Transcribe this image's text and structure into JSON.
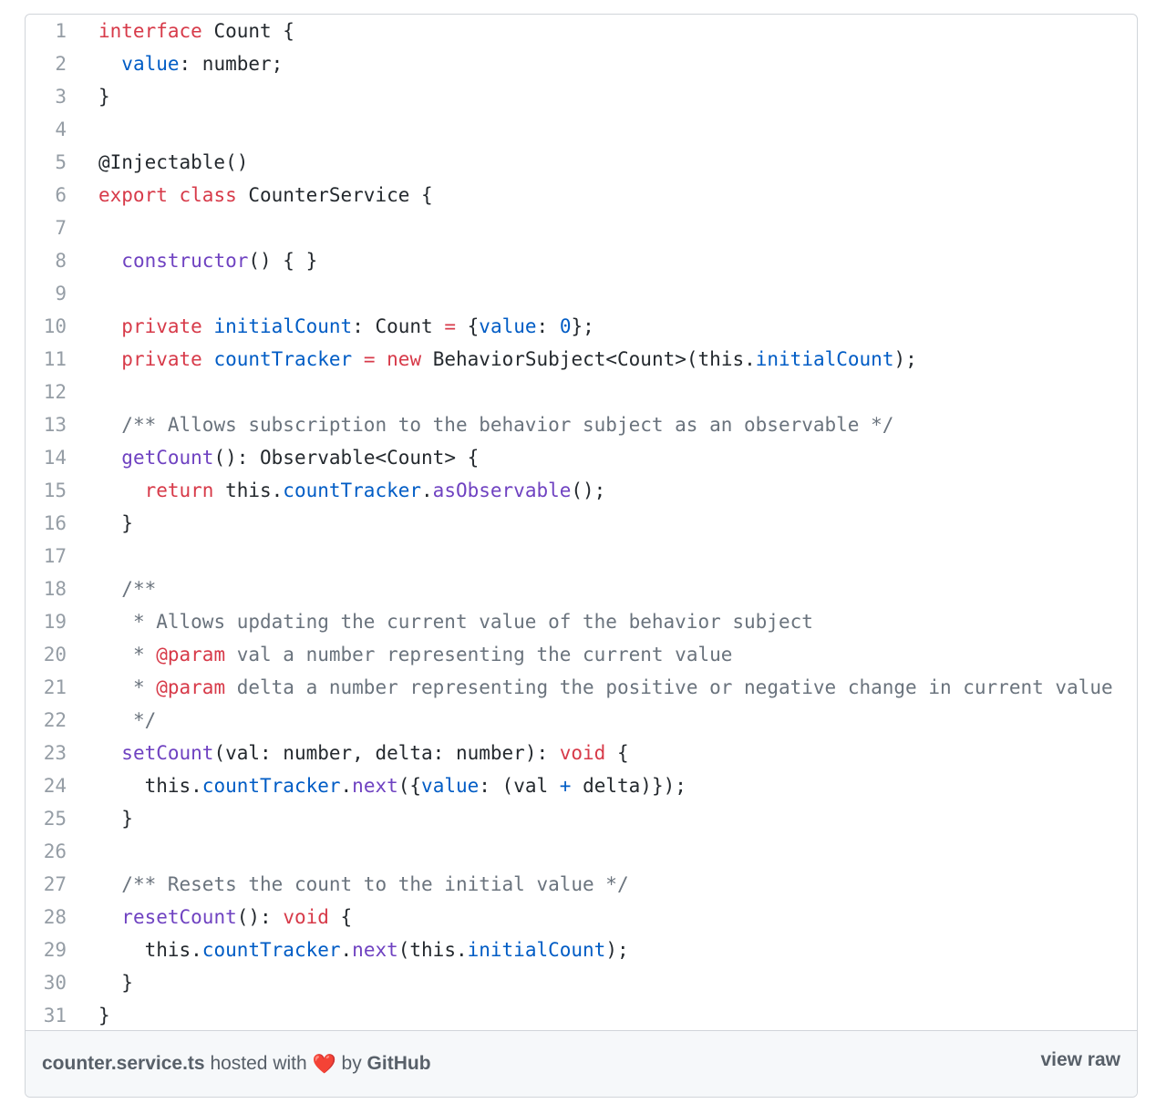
{
  "gist": {
    "filename": "counter.service.ts",
    "hosted_with": "hosted with",
    "heart": "❤️",
    "by": "by",
    "host": "GitHub",
    "view_raw": "view raw"
  },
  "code_lines": [
    [
      {
        "t": "interface",
        "c": "k"
      },
      {
        "t": " Count {"
      }
    ],
    [
      {
        "t": "  "
      },
      {
        "t": "value",
        "c": "v"
      },
      {
        "t": ": number;"
      }
    ],
    [
      {
        "t": "}"
      }
    ],
    [],
    [
      {
        "t": "@Injectable()"
      }
    ],
    [
      {
        "t": "export",
        "c": "k"
      },
      {
        "t": " "
      },
      {
        "t": "class",
        "c": "k"
      },
      {
        "t": " CounterService {"
      }
    ],
    [],
    [
      {
        "t": "  "
      },
      {
        "t": "constructor",
        "c": "f"
      },
      {
        "t": "() { }"
      }
    ],
    [],
    [
      {
        "t": "  "
      },
      {
        "t": "private",
        "c": "k"
      },
      {
        "t": " "
      },
      {
        "t": "initialCount",
        "c": "v"
      },
      {
        "t": ": Count "
      },
      {
        "t": "=",
        "c": "k"
      },
      {
        "t": " {"
      },
      {
        "t": "value",
        "c": "v"
      },
      {
        "t": ": "
      },
      {
        "t": "0",
        "c": "v"
      },
      {
        "t": "};"
      }
    ],
    [
      {
        "t": "  "
      },
      {
        "t": "private",
        "c": "k"
      },
      {
        "t": " "
      },
      {
        "t": "countTracker",
        "c": "v"
      },
      {
        "t": " "
      },
      {
        "t": "=",
        "c": "k"
      },
      {
        "t": " "
      },
      {
        "t": "new",
        "c": "k"
      },
      {
        "t": " BehaviorSubject<Count>(this."
      },
      {
        "t": "initialCount",
        "c": "v"
      },
      {
        "t": ");"
      }
    ],
    [],
    [
      {
        "t": "  "
      },
      {
        "t": "/** Allows subscription to the behavior subject as an observable */",
        "c": "c"
      }
    ],
    [
      {
        "t": "  "
      },
      {
        "t": "getCount",
        "c": "f"
      },
      {
        "t": "(): Observable<Count> {"
      }
    ],
    [
      {
        "t": "    "
      },
      {
        "t": "return",
        "c": "k"
      },
      {
        "t": " this."
      },
      {
        "t": "countTracker",
        "c": "v"
      },
      {
        "t": "."
      },
      {
        "t": "asObservable",
        "c": "f"
      },
      {
        "t": "();"
      }
    ],
    [
      {
        "t": "  }"
      }
    ],
    [],
    [
      {
        "t": "  "
      },
      {
        "t": "/**",
        "c": "c"
      }
    ],
    [
      {
        "t": "   "
      },
      {
        "t": "* Allows updating the current value of the behavior subject",
        "c": "c"
      }
    ],
    [
      {
        "t": "   "
      },
      {
        "t": "* ",
        "c": "c"
      },
      {
        "t": "@param",
        "c": "k"
      },
      {
        "t": " val a number representing the current value",
        "c": "c"
      }
    ],
    [
      {
        "t": "   "
      },
      {
        "t": "* ",
        "c": "c"
      },
      {
        "t": "@param",
        "c": "k"
      },
      {
        "t": " delta a number representing the positive or negative change in current value",
        "c": "c"
      }
    ],
    [
      {
        "t": "   "
      },
      {
        "t": "*/",
        "c": "c"
      }
    ],
    [
      {
        "t": "  "
      },
      {
        "t": "setCount",
        "c": "f"
      },
      {
        "t": "(val: number, delta: number): "
      },
      {
        "t": "void",
        "c": "k"
      },
      {
        "t": " {"
      }
    ],
    [
      {
        "t": "    this."
      },
      {
        "t": "countTracker",
        "c": "v"
      },
      {
        "t": "."
      },
      {
        "t": "next",
        "c": "f"
      },
      {
        "t": "({"
      },
      {
        "t": "value",
        "c": "v"
      },
      {
        "t": ": (val "
      },
      {
        "t": "+",
        "c": "v"
      },
      {
        "t": " delta)});"
      }
    ],
    [
      {
        "t": "  }"
      }
    ],
    [],
    [
      {
        "t": "  "
      },
      {
        "t": "/** Resets the count to the initial value */",
        "c": "c"
      }
    ],
    [
      {
        "t": "  "
      },
      {
        "t": "resetCount",
        "c": "f"
      },
      {
        "t": "(): "
      },
      {
        "t": "void",
        "c": "k"
      },
      {
        "t": " {"
      }
    ],
    [
      {
        "t": "    this."
      },
      {
        "t": "countTracker",
        "c": "v"
      },
      {
        "t": "."
      },
      {
        "t": "next",
        "c": "f"
      },
      {
        "t": "(this."
      },
      {
        "t": "initialCount",
        "c": "v"
      },
      {
        "t": ");"
      }
    ],
    [
      {
        "t": "  }"
      }
    ],
    [
      {
        "t": "}"
      }
    ]
  ],
  "colors": {
    "keyword": "#d73a49",
    "variable": "#005cc5",
    "function": "#6f42c1",
    "comment": "#6a737d",
    "line_number": "#959da5",
    "text": "#24292e"
  }
}
